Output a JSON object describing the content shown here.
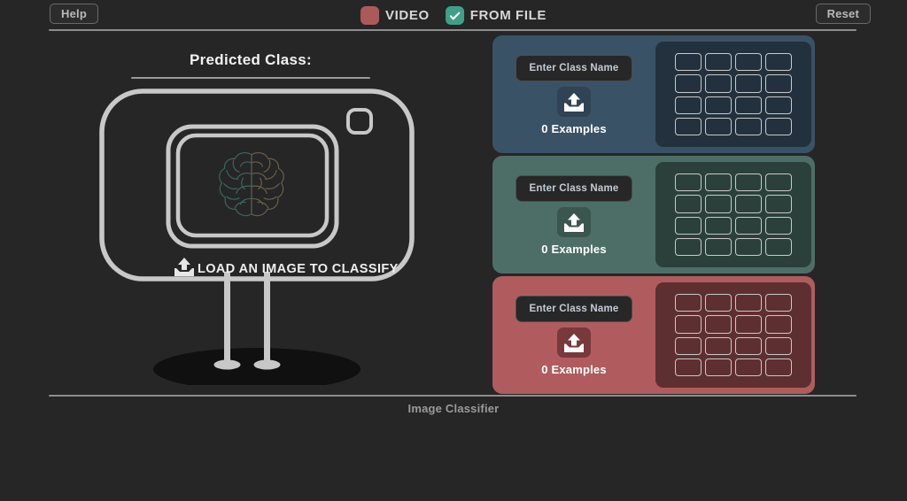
{
  "app": {
    "footer_title": "Image Classifier",
    "background_color": "#262626"
  },
  "topbar": {
    "help_label": "Help",
    "reset_label": "Reset",
    "toggles": [
      {
        "label": "VIDEO",
        "checked": false,
        "color": "#ab5a5a",
        "icon": "unchecked-box-icon"
      },
      {
        "label": "FROM FILE",
        "checked": true,
        "color": "#3fa08a",
        "icon": "check-icon"
      }
    ]
  },
  "prediction": {
    "title": "Predicted Class:",
    "value": "",
    "dropzone_label": "LOAD AN IMAGE TO CLASSIFY",
    "dropzone_icon": "upload-icon",
    "screen_icon": "brain-icon",
    "brain_left_color": "#3f6660",
    "brain_right_color": "#6b6147",
    "frame_color": "#c8c8c8"
  },
  "classes": [
    {
      "id": "class-1",
      "name_value": "",
      "name_placeholder": "Enter Class Name",
      "examples_label": "0 Examples",
      "examples_count": 0,
      "upload_icon": "upload-icon",
      "panel_color": "#3a5266",
      "grid_color": "#22313d",
      "button_color": "#2f4354",
      "grid_rows": 4,
      "grid_cols": 4
    },
    {
      "id": "class-2",
      "name_value": "",
      "name_placeholder": "Enter Class Name",
      "examples_label": "0 Examples",
      "examples_count": 0,
      "upload_icon": "upload-icon",
      "panel_color": "#4d6e66",
      "grid_color": "#2b403b",
      "button_color": "#3b564f",
      "grid_rows": 4,
      "grid_cols": 4
    },
    {
      "id": "class-3",
      "name_value": "",
      "name_placeholder": "Enter Class Name",
      "examples_label": "0 Examples",
      "examples_count": 0,
      "upload_icon": "upload-icon",
      "panel_color": "#b05c5e",
      "grid_color": "#5e2f30",
      "button_color": "#77393b",
      "grid_rows": 4,
      "grid_cols": 4
    }
  ]
}
